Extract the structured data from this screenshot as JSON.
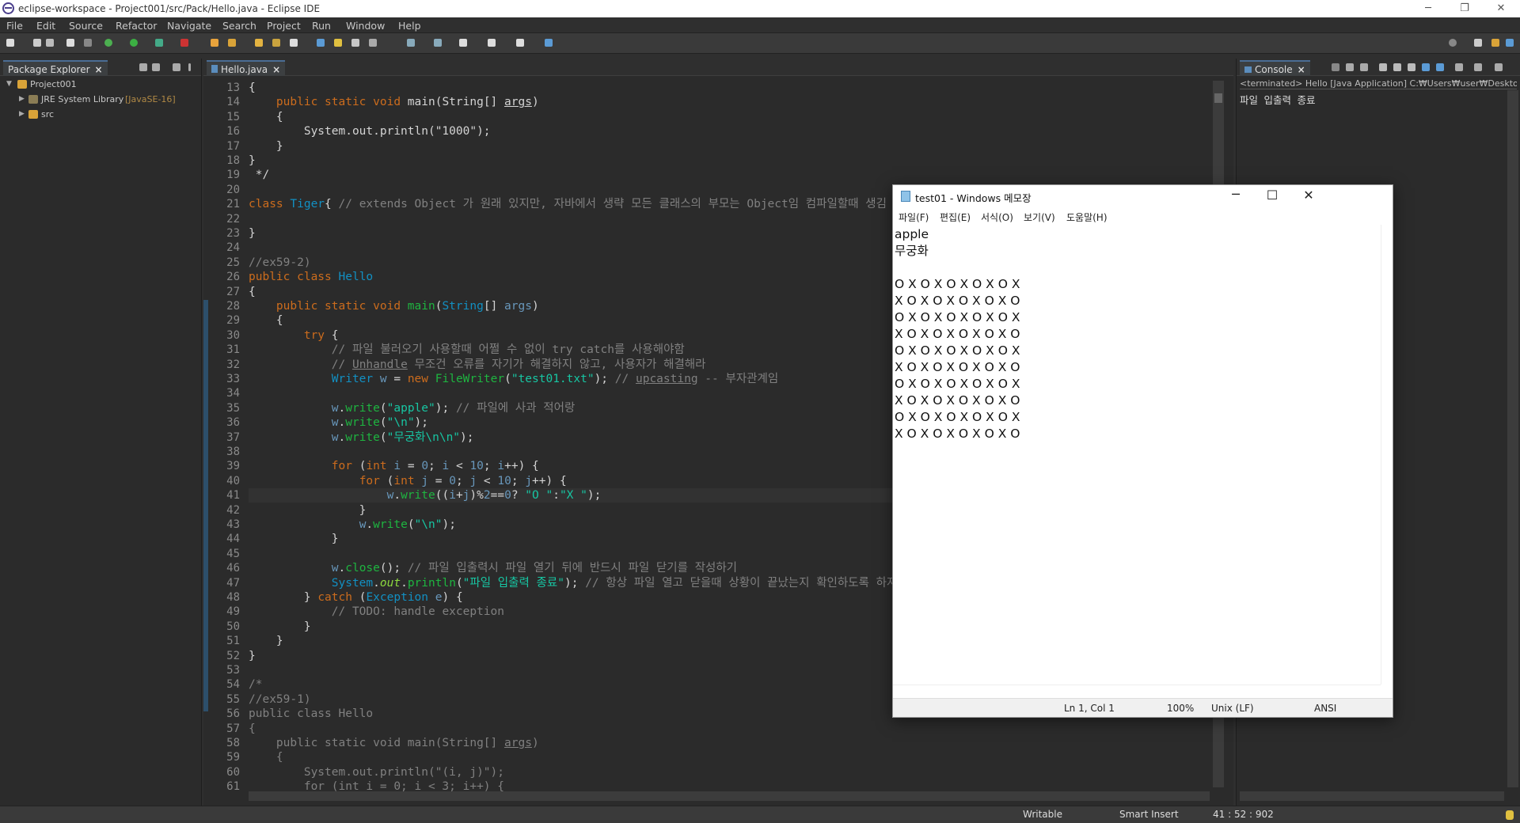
{
  "window": {
    "title": "eclipse-workspace - Project001/src/Pack/Hello.java - Eclipse IDE",
    "min": "─",
    "restore": "❐",
    "close": "✕"
  },
  "menu": [
    "File",
    "Edit",
    "Source",
    "Refactor",
    "Navigate",
    "Search",
    "Project",
    "Run",
    "Window",
    "Help"
  ],
  "package_explorer": {
    "tab": "Package Explorer",
    "project": "Project001",
    "jre": "JRE System Library",
    "jre_version": "[JavaSE-16]",
    "src": "src"
  },
  "editor": {
    "tab": "Hello.java",
    "lines": [
      {
        "n": "13",
        "h": "{"
      },
      {
        "n": "14",
        "h": "    <span class='kw'>public static void</span> main(String[] <u>args</u>)"
      },
      {
        "n": "15",
        "h": "    {"
      },
      {
        "n": "16",
        "h": "        System.out.println(\"1000\");"
      },
      {
        "n": "17",
        "h": "    }"
      },
      {
        "n": "18",
        "h": "}"
      },
      {
        "n": "19",
        "h": " */"
      },
      {
        "n": "20",
        "h": ""
      },
      {
        "n": "21",
        "h": "<span class='kw'>class</span> <span class='ty'>Tiger</span>{ <span class='cm'>// extends Object 가 원래 있지만, 자바에서 생략 모든 클래스의 부모는 Object임 컴파일할때 생김</span>"
      },
      {
        "n": "22",
        "h": ""
      },
      {
        "n": "23",
        "h": "}"
      },
      {
        "n": "24",
        "h": ""
      },
      {
        "n": "25",
        "h": "<span class='cm'>//ex59-2)</span>"
      },
      {
        "n": "26",
        "h": "<span class='kw'>public class</span> <span class='ty'>Hello</span>"
      },
      {
        "n": "27",
        "h": "{"
      },
      {
        "n": "28",
        "h": "    <span class='kw'>public static void</span> <span class='fn'>main</span>(<span class='ty'>String</span>[] <span class='nm'>args</span>)"
      },
      {
        "n": "29",
        "h": "    {"
      },
      {
        "n": "30",
        "h": "        <span class='kw'>try</span> {"
      },
      {
        "n": "31",
        "h": "            <span class='cm'>// 파일 불러오기 사용할때 어쩔 수 없이 try catch를 사용해야함</span>"
      },
      {
        "n": "32",
        "h": "            <span class='cm'>// <u>Unhandle</u> 무조건 오류를 자기가 해결하지 않고, 사용자가 해결해라</span>"
      },
      {
        "n": "33",
        "h": "            <span class='ty'>Writer</span> <span class='nm'>w</span> = <span class='kw'>new</span> <span class='fn'>FileWriter</span>(<span class='st'>\"test01.txt\"</span>); <span class='cm'>// <u>upcasting</u> -- 부자관계임</span>"
      },
      {
        "n": "34",
        "h": ""
      },
      {
        "n": "35",
        "h": "            <span class='nm'>w</span>.<span class='fn'>write</span>(<span class='st'>\"apple\"</span>); <span class='cm'>// 파일에 사과 적어랑</span>"
      },
      {
        "n": "36",
        "h": "            <span class='nm'>w</span>.<span class='fn'>write</span>(<span class='st'>\"\\n\"</span>);"
      },
      {
        "n": "37",
        "h": "            <span class='nm'>w</span>.<span class='fn'>write</span>(<span class='st'>\"무궁화\\n\\n\"</span>);"
      },
      {
        "n": "38",
        "h": ""
      },
      {
        "n": "39",
        "h": "            <span class='kw'>for</span> (<span class='kw'>int</span> <span class='nm'>i</span> = <span class='nm'>0</span>; <span class='nm'>i</span> &lt; <span class='nm'>10</span>; <span class='nm'>i</span>++) {"
      },
      {
        "n": "40",
        "h": "                <span class='kw'>for</span> (<span class='kw'>int</span> <span class='nm'>j</span> = <span class='nm'>0</span>; <span class='nm'>j</span> &lt; <span class='nm'>10</span>; <span class='nm'>j</span>++) {"
      },
      {
        "n": "41",
        "h": "                    <span class='nm'>w</span>.<span class='fn'>write</span>((<span class='nm'>i</span>+<span class='nm'>j</span>)%<span class='nm'>2</span>==<span class='nm'>0</span>? <span class='st'>\"O \"</span>:<span class='st'>\"X \"</span>);"
      },
      {
        "n": "42",
        "h": "                }"
      },
      {
        "n": "43",
        "h": "                <span class='nm'>w</span>.<span class='fn'>write</span>(<span class='st'>\"\\n\"</span>);"
      },
      {
        "n": "44",
        "h": "            }"
      },
      {
        "n": "45",
        "h": ""
      },
      {
        "n": "46",
        "h": "            <span class='nm'>w</span>.<span class='fn'>close</span>(); <span class='cm'>// 파일 입출력시 파일 열기 뒤에 반드시 파일 닫기를 작성하기</span>"
      },
      {
        "n": "47",
        "h": "            <span class='ty'>System</span>.<span class='fd'><i>out</i></span>.<span class='fn'>println</span>(<span class='st'>\"파일 입출력 종료\"</span>); <span class='cm'>// 항상 파일 열고 닫을때 상황이 끝났는지 확인하도록 하자</span>"
      },
      {
        "n": "48",
        "h": "        } <span class='kw'>catch</span> (<span class='ty'>Exception</span> <span class='nm'>e</span>) {"
      },
      {
        "n": "49",
        "h": "            <span class='cm'>// TODO: handle exception</span>"
      },
      {
        "n": "50",
        "h": "        }"
      },
      {
        "n": "51",
        "h": "    }"
      },
      {
        "n": "52",
        "h": "}"
      },
      {
        "n": "53",
        "h": ""
      },
      {
        "n": "54",
        "h": "<span class='cm'>/*</span>"
      },
      {
        "n": "55",
        "h": "<span class='cm'>//ex59-1)</span>"
      },
      {
        "n": "56",
        "h": "<span class='cm'>public class Hello</span>"
      },
      {
        "n": "57",
        "h": "<span class='cm'>{</span>"
      },
      {
        "n": "58",
        "h": "<span class='cm'>    public static void main(String[] <u>args</u>)</span>"
      },
      {
        "n": "59",
        "h": "<span class='cm'>    {</span>"
      },
      {
        "n": "60",
        "h": "<span class='cm'>        System.out.println(\"(i, j)\");</span>"
      },
      {
        "n": "61",
        "h": "<span class='cm'>        for (int i = 0; i &lt; 3; i++) {</span>"
      }
    ]
  },
  "console": {
    "tab": "Console",
    "header": "<terminated> Hello [Java Application] C:₩Users₩user₩Desktop₩",
    "output": "파일 입출력 종료"
  },
  "notepad": {
    "title": "test01 - Windows 메모장",
    "menu": [
      "파일(F)",
      "편집(E)",
      "서식(O)",
      "보기(V)",
      "도움말(H)"
    ],
    "text": "apple\n무궁화\n\nO X O X O X O X O X\nX O X O X O X O X O\nO X O X O X O X O X\nX O X O X O X O X O\nO X O X O X O X O X\nX O X O X O X O X O\nO X O X O X O X O X\nX O X O X O X O X O\nO X O X O X O X O X\nX O X O X O X O X O",
    "status": {
      "pos": "Ln 1, Col 1",
      "zoom": "100%",
      "eol": "Unix (LF)",
      "enc": "ANSI"
    }
  },
  "statusbar": {
    "writable": "Writable",
    "insert": "Smart Insert",
    "position": "41 : 52 : 902"
  }
}
